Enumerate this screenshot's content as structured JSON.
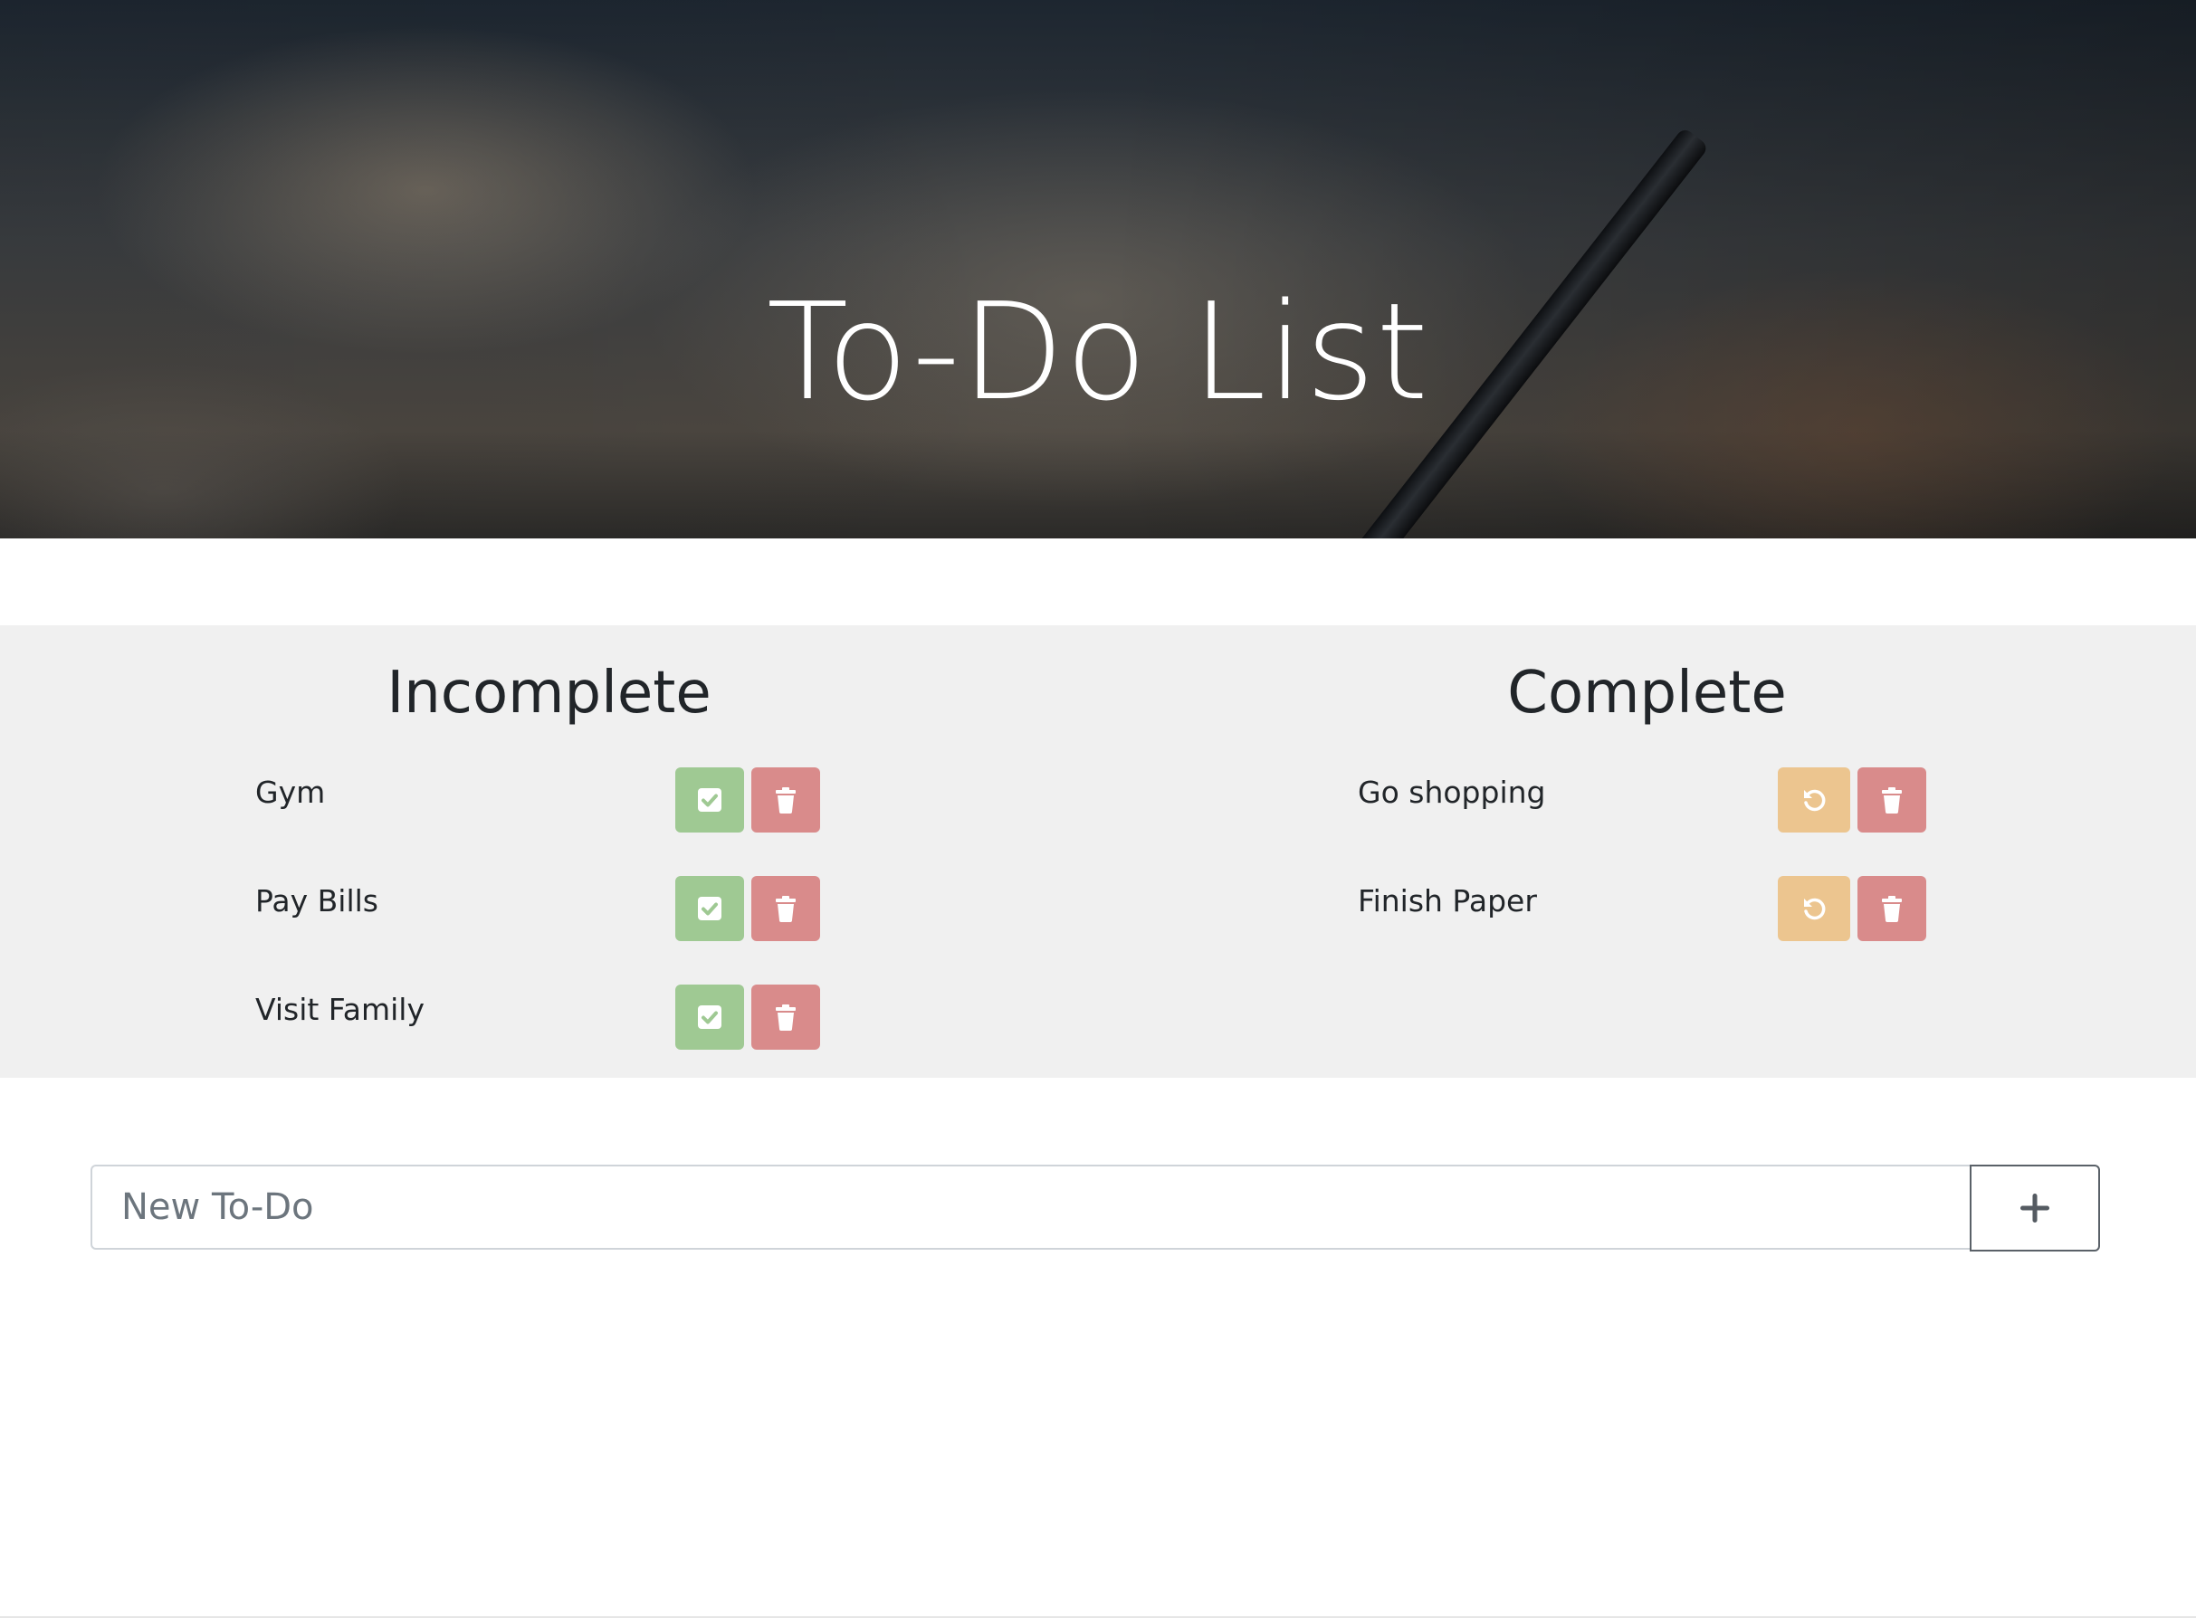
{
  "header": {
    "title": "To-Do List"
  },
  "incomplete": {
    "heading": "Incomplete",
    "items": [
      {
        "text": "Gym"
      },
      {
        "text": "Pay Bills"
      },
      {
        "text": "Visit Family"
      }
    ]
  },
  "complete": {
    "heading": "Complete",
    "items": [
      {
        "text": "Go shopping"
      },
      {
        "text": "Finish Paper"
      }
    ]
  },
  "new_todo": {
    "placeholder": "New To-Do",
    "add_icon": "plus-icon"
  },
  "colors": {
    "done": "#9fc993",
    "undo": "#ecc58f",
    "delete": "#d98b8b",
    "panel_bg": "#f0f0f0"
  },
  "icons": {
    "done": "check-square-icon",
    "undo": "undo-icon",
    "delete": "trash-icon"
  }
}
